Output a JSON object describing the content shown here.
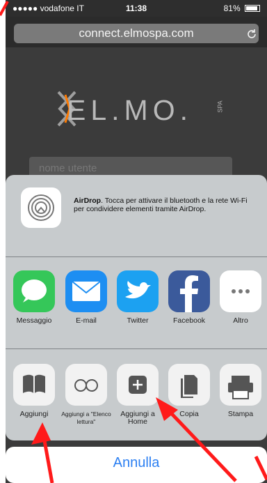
{
  "status_bar": {
    "carrier": "●●●●● vodafone IT",
    "time": "11:38",
    "battery": "81%"
  },
  "browser": {
    "url": "connect.elmospa.com",
    "reload_icon": "reload-icon"
  },
  "page": {
    "logo_text": "EL.MO.",
    "logo_suffix": "SPA",
    "username_placeholder": "nome utente"
  },
  "share_sheet": {
    "airdrop": {
      "title": "AirDrop",
      "text": ". Tocca per attivare il bluetooth e la rete Wi-Fi per condividere elementi tramite AirDrop."
    },
    "apps": [
      {
        "label": "Messaggio",
        "icon": "messages-icon",
        "color": "#35c759"
      },
      {
        "label": "E-mail",
        "icon": "mail-icon",
        "color": "#1d8ef2"
      },
      {
        "label": "Twitter",
        "icon": "twitter-icon",
        "color": "#1ca1f1"
      },
      {
        "label": "Facebook",
        "icon": "facebook-icon",
        "color": "#3b5a9b"
      },
      {
        "label": "Altro",
        "icon": "more-icon",
        "color": "#ffffff"
      }
    ],
    "actions": [
      {
        "label": "Aggiungi",
        "icon": "bookmark-icon"
      },
      {
        "label": "Aggiungi a \"Elenco lettura\"",
        "icon": "reading-list-icon"
      },
      {
        "label": "Aggiungi a Home",
        "icon": "add-to-home-icon"
      },
      {
        "label": "Copia",
        "icon": "copy-icon"
      },
      {
        "label": "Stampa",
        "icon": "print-icon"
      }
    ],
    "cancel_label": "Annulla"
  },
  "annotations": {
    "arrow_color": "#ff1a1a"
  }
}
